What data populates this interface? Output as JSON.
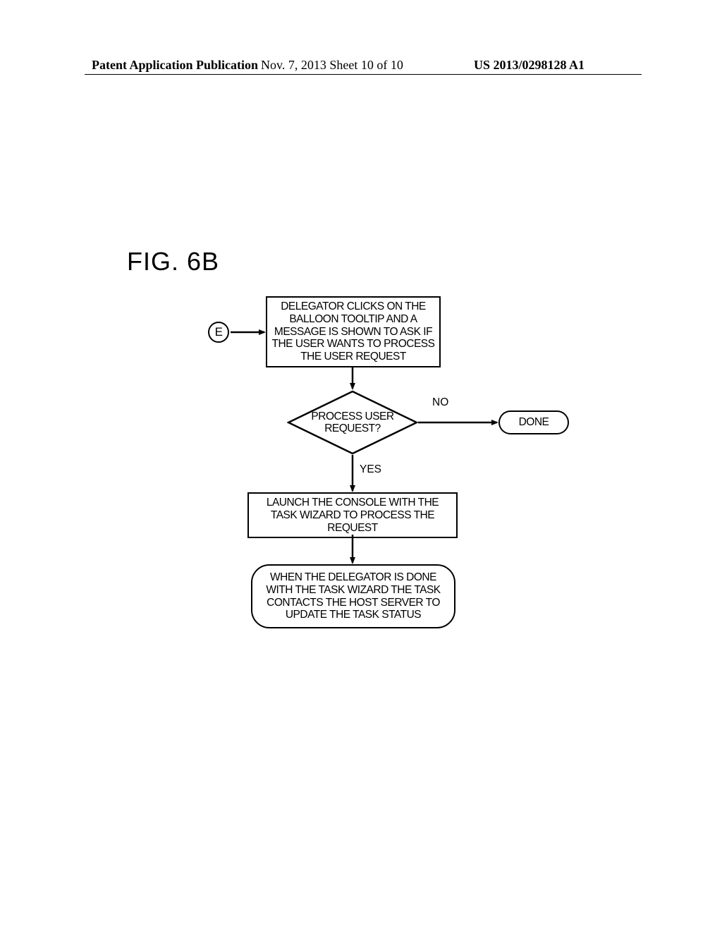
{
  "header": {
    "left": "Patent Application Publication",
    "center": "Nov. 7, 2013  Sheet 10 of 10",
    "right": "US 2013/0298128 A1"
  },
  "figure_label": "FIG. 6B",
  "connector": {
    "label": "E"
  },
  "box1": {
    "text": "DELEGATOR CLICKS ON THE BALLOON TOOLTIP AND A MESSAGE IS SHOWN TO ASK IF THE USER WANTS TO PROCESS THE USER REQUEST"
  },
  "decision": {
    "text": "PROCESS USER REQUEST?",
    "no_label": "NO",
    "yes_label": "YES"
  },
  "done": {
    "text": "DONE"
  },
  "box2": {
    "text": "LAUNCH THE CONSOLE WITH THE TASK WIZARD TO PROCESS THE REQUEST"
  },
  "terminal": {
    "text": "WHEN THE DELEGATOR IS DONE WITH THE TASK WIZARD THE TASK CONTACTS THE HOST SERVER TO UPDATE THE TASK STATUS"
  }
}
